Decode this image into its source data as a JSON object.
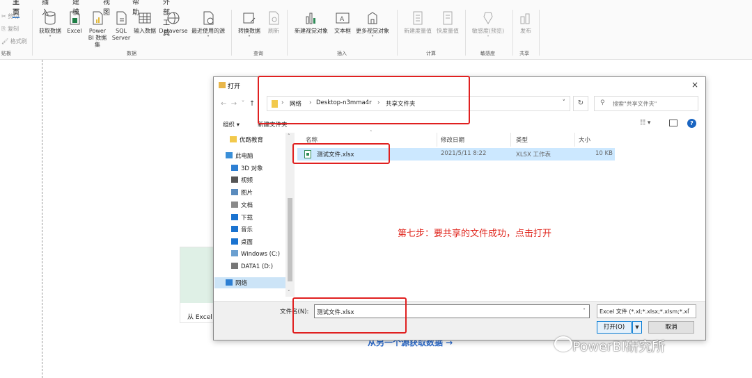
{
  "ribbon": {
    "tabs": [
      "主页",
      "插入",
      "建模",
      "视图",
      "帮助",
      "外部工具"
    ],
    "clipboard": {
      "cut": "剪切",
      "copy": "复制",
      "format_painter": "格式刷",
      "label": "贴板"
    },
    "data_group": {
      "label": "数据",
      "buttons": [
        "获取数据",
        "Excel",
        "Power BI 数据集",
        "SQL Server",
        "输入数据",
        "Dataverse",
        "最近使用的源"
      ]
    },
    "query_group": {
      "label": "查询",
      "buttons": [
        "转换数据",
        "刷新"
      ]
    },
    "insert_group": {
      "label": "插入",
      "buttons": [
        "新建视觉对象",
        "文本框",
        "更多视觉对象"
      ]
    },
    "calc_group": {
      "label": "计算",
      "buttons": [
        "新建度量值",
        "快度量值"
      ]
    },
    "sensitivity_group": {
      "label": "敏感度",
      "buttons": [
        "敏感度(预览)"
      ]
    },
    "share_group": {
      "label": "共享",
      "buttons": [
        "发布"
      ]
    }
  },
  "background": {
    "card_label": "从 Excel",
    "link_text": "从另一个源获取数据 →"
  },
  "dialog": {
    "title": "打开",
    "close": "×",
    "breadcrumbs": [
      "网络",
      "Desktop-n3mma4r",
      "共享文件夹"
    ],
    "search_placeholder": "搜索\"共享文件夹\"",
    "organize": "组织 ▾",
    "new_folder": "新建文件夹",
    "nav_items": [
      {
        "label": "优路教育",
        "color": "#f2c94c"
      },
      {
        "label": "此电脑",
        "color": "#3a8fd8"
      },
      {
        "label": "3D 对象",
        "color": "#2d7fd3"
      },
      {
        "label": "视频",
        "color": "#555555"
      },
      {
        "label": "图片",
        "color": "#5a8bbd"
      },
      {
        "label": "文档",
        "color": "#8a8a8a"
      },
      {
        "label": "下载",
        "color": "#1a73d0"
      },
      {
        "label": "音乐",
        "color": "#1a73d0"
      },
      {
        "label": "桌面",
        "color": "#1a73d0"
      },
      {
        "label": "Windows (C:)",
        "color": "#6b9fd0"
      },
      {
        "label": "DATA1 (D:)",
        "color": "#777777"
      },
      {
        "label": "网络",
        "color": "#2d7fd3"
      }
    ],
    "columns": [
      "名称",
      "修改日期",
      "类型",
      "大小"
    ],
    "file": {
      "name": "测试文件.xlsx",
      "date": "2021/5/11 8:22",
      "type": "XLSX 工作表",
      "size": "10 KB"
    },
    "annotation": "第七步：要共享的文件成功，点击打开",
    "filename_label": "文件名(N):",
    "filename_value": "测试文件.xlsx",
    "filetype": "Excel 文件 (*.xl;*.xlsx;*.xlsm;*.xl",
    "open_button": "打开(O)",
    "cancel_button": "取消"
  },
  "watermark": "PowerBI研究所",
  "colors": {
    "accent": "#0078d4",
    "highlight_red": "#e02020",
    "selection": "#cce8ff"
  }
}
